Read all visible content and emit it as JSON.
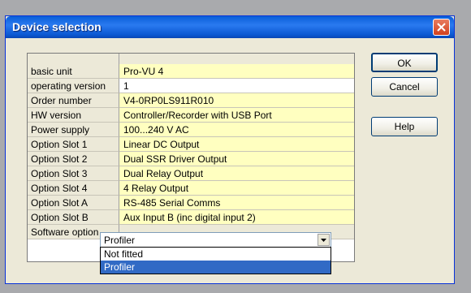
{
  "dialog": {
    "title": "Device selection",
    "buttons": {
      "ok": "OK",
      "cancel": "Cancel",
      "help": "Help"
    }
  },
  "grid": {
    "rows": [
      {
        "label": "basic unit",
        "value": "Pro-VU 4"
      },
      {
        "label": "operating version",
        "value": "1"
      },
      {
        "label": "Order number",
        "value": "V4-0RP0LS911R010"
      },
      {
        "label": "HW version",
        "value": "Controller/Recorder with USB Port"
      },
      {
        "label": "Power supply",
        "value": "100...240 V AC"
      },
      {
        "label": "Option Slot 1",
        "value": "Linear DC Output"
      },
      {
        "label": "Option Slot 2",
        "value": "Dual SSR Driver Output"
      },
      {
        "label": "Option Slot 3",
        "value": "Dual Relay Output"
      },
      {
        "label": "Option Slot 4",
        "value": "4 Relay Output"
      },
      {
        "label": "Option Slot A",
        "value": "RS-485 Serial Comms"
      },
      {
        "label": "Option Slot B",
        "value": "Aux Input B (inc digital input 2)"
      }
    ],
    "software_option": {
      "label": "Software option",
      "selected": "Profiler",
      "options": [
        "Not fitted",
        "Profiler"
      ]
    }
  },
  "icons": {
    "close": "close-icon",
    "dropdown": "chevron-down-icon"
  },
  "colors": {
    "titlebar": "#0a5fd8",
    "value_cell": "#ffffc0",
    "selection": "#316ac5"
  }
}
